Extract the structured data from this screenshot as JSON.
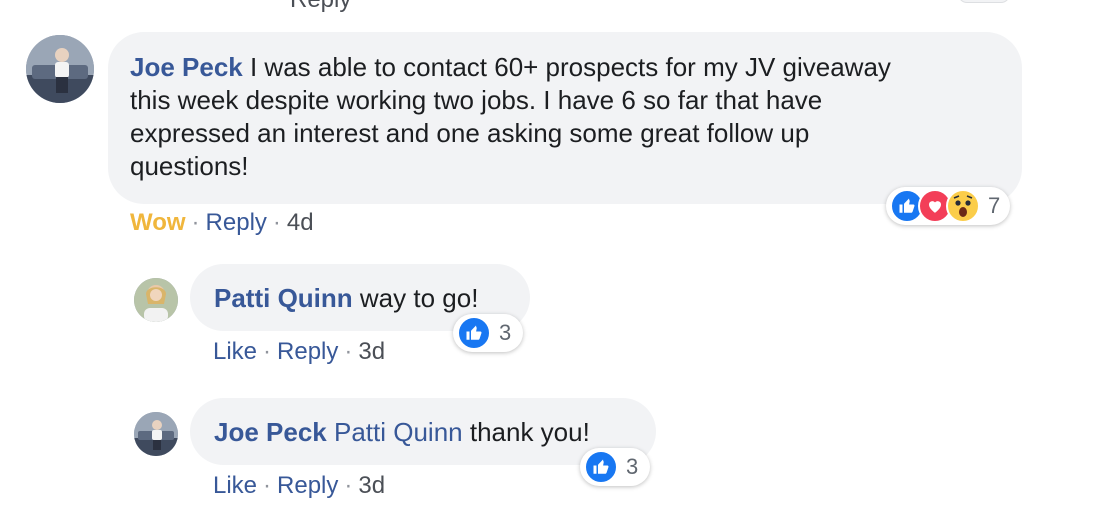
{
  "top_partial": {
    "reply_text": "Reply"
  },
  "comments": [
    {
      "author": "Joe Peck",
      "mention": "",
      "text_lines": [
        "I was able to contact 60+ prospects for my JV giveaway",
        "this week despite working two jobs. I have 6 so far that have",
        "expressed an interest and one asking some great follow up",
        "questions!"
      ],
      "reaction_label": "Wow",
      "reply_label": "Reply",
      "separator": "·",
      "time": "4d",
      "reaction_icons": [
        "like-icon",
        "love-icon",
        "wow-icon"
      ],
      "reaction_count": "7"
    },
    {
      "author": "Patti Quinn",
      "text": "way to go!",
      "like_label": "Like",
      "reply_label": "Reply",
      "separator": "·",
      "time": "3d",
      "reaction_icons": [
        "like-icon"
      ],
      "reaction_count": "3"
    },
    {
      "author": "Joe Peck",
      "mention": "Patti Quinn",
      "text": "thank you!",
      "like_label": "Like",
      "reply_label": "Reply",
      "separator": "·",
      "time": "3d",
      "reaction_icons": [
        "like-icon"
      ],
      "reaction_count": "3"
    }
  ],
  "colors": {
    "author_blue": "#385898",
    "bubble_bg": "#f2f3f5",
    "wow_yellow": "#f0b63c",
    "like_blue": "#1877f2",
    "love_red": "#f33e58"
  }
}
